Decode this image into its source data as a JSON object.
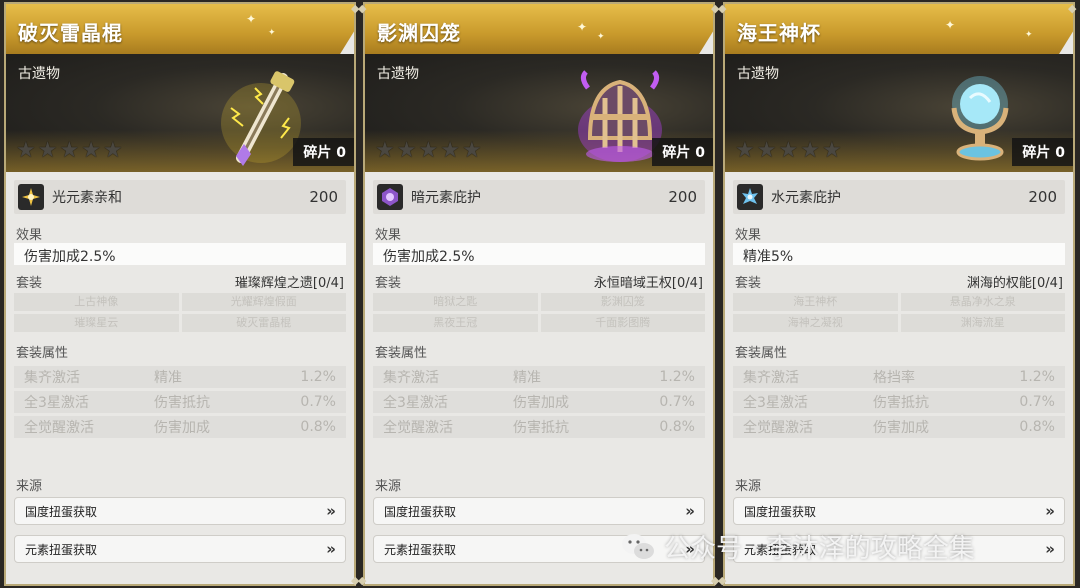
{
  "cards": [
    {
      "title": "破灭雷晶棍",
      "relic_type": "古遗物",
      "fragments": "碎片 0",
      "stars": 5,
      "art": "thunder-staff",
      "attribute": {
        "icon": "light-element-icon",
        "name": "光元素亲和",
        "value": "200"
      },
      "effect_label": "效果",
      "effect": "伤害加成2.5%",
      "set_label": "套装",
      "set_name": "璀璨辉煌之遗[0/4]",
      "set_items": [
        "上古神像",
        "光耀辉煌假面",
        "璀璨星云",
        "破灭雷晶棍"
      ],
      "props_label": "套装属性",
      "props": [
        {
          "cond": "集齐激活",
          "stat": "精准",
          "val": "1.2%"
        },
        {
          "cond": "全3星激活",
          "stat": "伤害抵抗",
          "val": "0.7%"
        },
        {
          "cond": "全觉醒激活",
          "stat": "伤害加成",
          "val": "0.8%"
        }
      ],
      "source_label": "来源",
      "sources": [
        "国度扭蛋获取",
        "元素扭蛋获取"
      ]
    },
    {
      "title": "影渊囚笼",
      "relic_type": "古遗物",
      "fragments": "碎片 0",
      "stars": 5,
      "art": "shadow-cage",
      "attribute": {
        "icon": "dark-element-icon",
        "name": "暗元素庇护",
        "value": "200"
      },
      "effect_label": "效果",
      "effect": "伤害加成2.5%",
      "set_label": "套装",
      "set_name": "永恒暗域王权[0/4]",
      "set_items": [
        "暗狱之匙",
        "影渊囚笼",
        "黑夜王冠",
        "千面影图腾"
      ],
      "props_label": "套装属性",
      "props": [
        {
          "cond": "集齐激活",
          "stat": "精准",
          "val": "1.2%"
        },
        {
          "cond": "全3星激活",
          "stat": "伤害加成",
          "val": "0.7%"
        },
        {
          "cond": "全觉醒激活",
          "stat": "伤害抵抗",
          "val": "0.8%"
        }
      ],
      "source_label": "来源",
      "sources": [
        "国度扭蛋获取",
        "元素扭蛋获取"
      ]
    },
    {
      "title": "海王神杯",
      "relic_type": "古遗物",
      "fragments": "碎片 0",
      "stars": 5,
      "art": "ocean-chalice",
      "attribute": {
        "icon": "water-element-icon",
        "name": "水元素庇护",
        "value": "200"
      },
      "effect_label": "效果",
      "effect": "精准5%",
      "set_label": "套装",
      "set_name": "渊海的权能[0/4]",
      "set_items": [
        "海王神杯",
        "悬晶净水之泉",
        "海神之凝视",
        "渊海流星"
      ],
      "props_label": "套装属性",
      "props": [
        {
          "cond": "集齐激活",
          "stat": "格挡率",
          "val": "1.2%"
        },
        {
          "cond": "全3星激活",
          "stat": "伤害抵抗",
          "val": "0.7%"
        },
        {
          "cond": "全觉醒激活",
          "stat": "伤害加成",
          "val": "0.8%"
        }
      ],
      "source_label": "来源",
      "sources": [
        "国度扭蛋获取",
        "元素扭蛋获取"
      ]
    }
  ],
  "watermark": {
    "text": "公众号 · 李沐泽的攻略全集",
    "icon": "wechat-icon"
  },
  "colors": {
    "gold": "#c99a2c",
    "panel": "#e9e8e5",
    "dark": "#1d1c1a"
  }
}
